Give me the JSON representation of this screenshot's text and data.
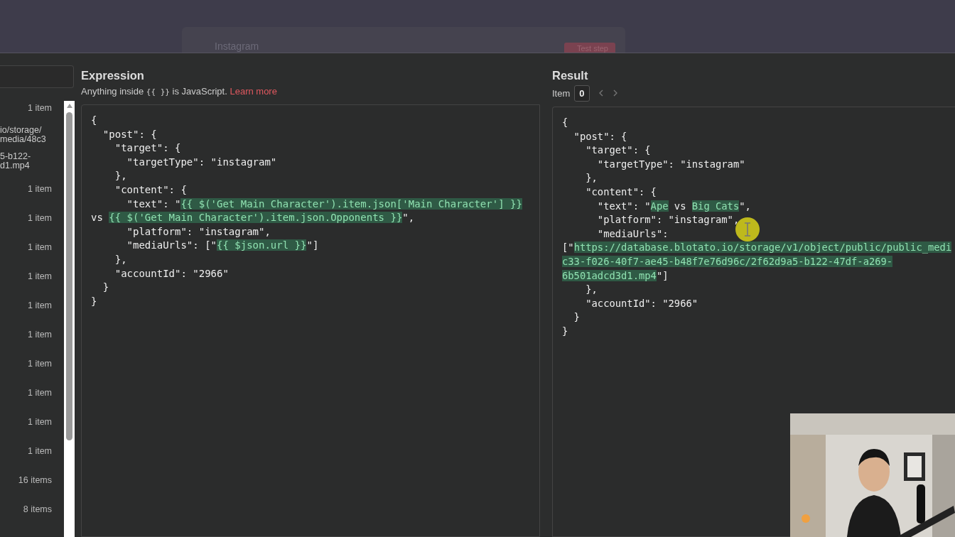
{
  "background": {
    "node_title": "Instagram",
    "button": "Test step"
  },
  "input_panel": {
    "items": [
      {
        "kind": "count",
        "lines": [
          "1 item"
        ]
      },
      {
        "kind": "value",
        "lines": [
          "io/storage/",
          "media/48c3"
        ]
      },
      {
        "kind": "value",
        "lines": [
          "5-b122-",
          "d1.mp4"
        ]
      },
      {
        "kind": "count",
        "lines": [
          "1 item"
        ]
      },
      {
        "kind": "count",
        "lines": [
          "1 item"
        ]
      },
      {
        "kind": "count",
        "lines": [
          "1 item"
        ]
      },
      {
        "kind": "count",
        "lines": [
          "1 item"
        ]
      },
      {
        "kind": "count",
        "lines": [
          "1 item"
        ]
      },
      {
        "kind": "count",
        "lines": [
          "1 item"
        ]
      },
      {
        "kind": "count",
        "lines": [
          "1 item"
        ]
      },
      {
        "kind": "count",
        "lines": [
          "1 item"
        ]
      },
      {
        "kind": "count",
        "lines": [
          "1 item"
        ]
      },
      {
        "kind": "count",
        "lines": [
          "1 item"
        ]
      },
      {
        "kind": "count",
        "lines": [
          "16 items"
        ]
      },
      {
        "kind": "count",
        "lines": [
          "8 items"
        ]
      }
    ]
  },
  "expression": {
    "title": "Expression",
    "hint": {
      "before": "Anything inside",
      "code": "{{  }}",
      "after": "is JavaScript.",
      "link": "Learn more"
    },
    "lines": [
      [
        {
          "text": "{",
          "highlighted": false
        }
      ],
      [
        {
          "text": "  \"post\": {",
          "highlighted": false
        }
      ],
      [
        {
          "text": "    \"target\": {",
          "highlighted": false
        }
      ],
      [
        {
          "text": "      \"targetType\": \"instagram\"",
          "highlighted": false
        }
      ],
      [
        {
          "text": "    },",
          "highlighted": false
        }
      ],
      [
        {
          "text": "    \"content\": {",
          "highlighted": false
        }
      ],
      [
        {
          "text": "      \"text\": \"",
          "highlighted": false
        },
        {
          "text": "{{ $('Get Main Character').item.json['Main Character'] }}",
          "highlighted": true
        }
      ],
      [
        {
          "text": "vs ",
          "highlighted": false
        },
        {
          "text": "{{ $('Get Main Character').item.json.Opponents }}",
          "highlighted": true
        },
        {
          "text": "\",",
          "highlighted": false
        }
      ],
      [
        {
          "text": "      \"platform\": \"instagram\",",
          "highlighted": false
        }
      ],
      [
        {
          "text": "      \"mediaUrls\": [\"",
          "highlighted": false
        },
        {
          "text": "{{ $json.url }}",
          "highlighted": true
        },
        {
          "text": "\"]",
          "highlighted": false
        }
      ],
      [
        {
          "text": "    },",
          "highlighted": false
        }
      ],
      [
        {
          "text": "    \"accountId\": \"2966\"",
          "highlighted": false
        }
      ],
      [
        {
          "text": "  }",
          "highlighted": false
        }
      ],
      [
        {
          "text": "}",
          "highlighted": false
        }
      ]
    ]
  },
  "result": {
    "title": "Result",
    "item_label": "Item",
    "item_value": "0",
    "lines": [
      [
        {
          "text": "{",
          "highlighted": false
        }
      ],
      [
        {
          "text": "  \"post\": {",
          "highlighted": false
        }
      ],
      [
        {
          "text": "    \"target\": {",
          "highlighted": false
        }
      ],
      [
        {
          "text": "      \"targetType\": \"instagram\"",
          "highlighted": false
        }
      ],
      [
        {
          "text": "    },",
          "highlighted": false
        }
      ],
      [
        {
          "text": "    \"content\": {",
          "highlighted": false
        }
      ],
      [
        {
          "text": "      \"text\": \"",
          "highlighted": false
        },
        {
          "text": "Ape",
          "highlighted": true
        },
        {
          "text": " vs ",
          "highlighted": false
        },
        {
          "text": "Big Cats",
          "highlighted": true
        },
        {
          "text": "\",",
          "highlighted": false
        }
      ],
      [
        {
          "text": "      \"platform\": \"instagram\",",
          "highlighted": false
        }
      ],
      [
        {
          "text": "      \"mediaUrls\":",
          "highlighted": false
        }
      ],
      [
        {
          "text": "[\"",
          "highlighted": false
        },
        {
          "text": "https://database.blotato.io/storage/v1/object/public/public_medi",
          "highlighted": true
        }
      ],
      [
        {
          "text": "c33-f026-40f7-ae45-b48f7e76d96c/2f62d9a5-b122-47df-a269-",
          "highlighted": true
        }
      ],
      [
        {
          "text": "6b501adcd3d1.mp4",
          "highlighted": true
        },
        {
          "text": "\"]",
          "highlighted": false
        }
      ],
      [
        {
          "text": "    },",
          "highlighted": false
        }
      ],
      [
        {
          "text": "    \"accountId\": \"2966\"",
          "highlighted": false
        }
      ],
      [
        {
          "text": "  }",
          "highlighted": false
        }
      ],
      [
        {
          "text": "}",
          "highlighted": false
        }
      ]
    ]
  }
}
